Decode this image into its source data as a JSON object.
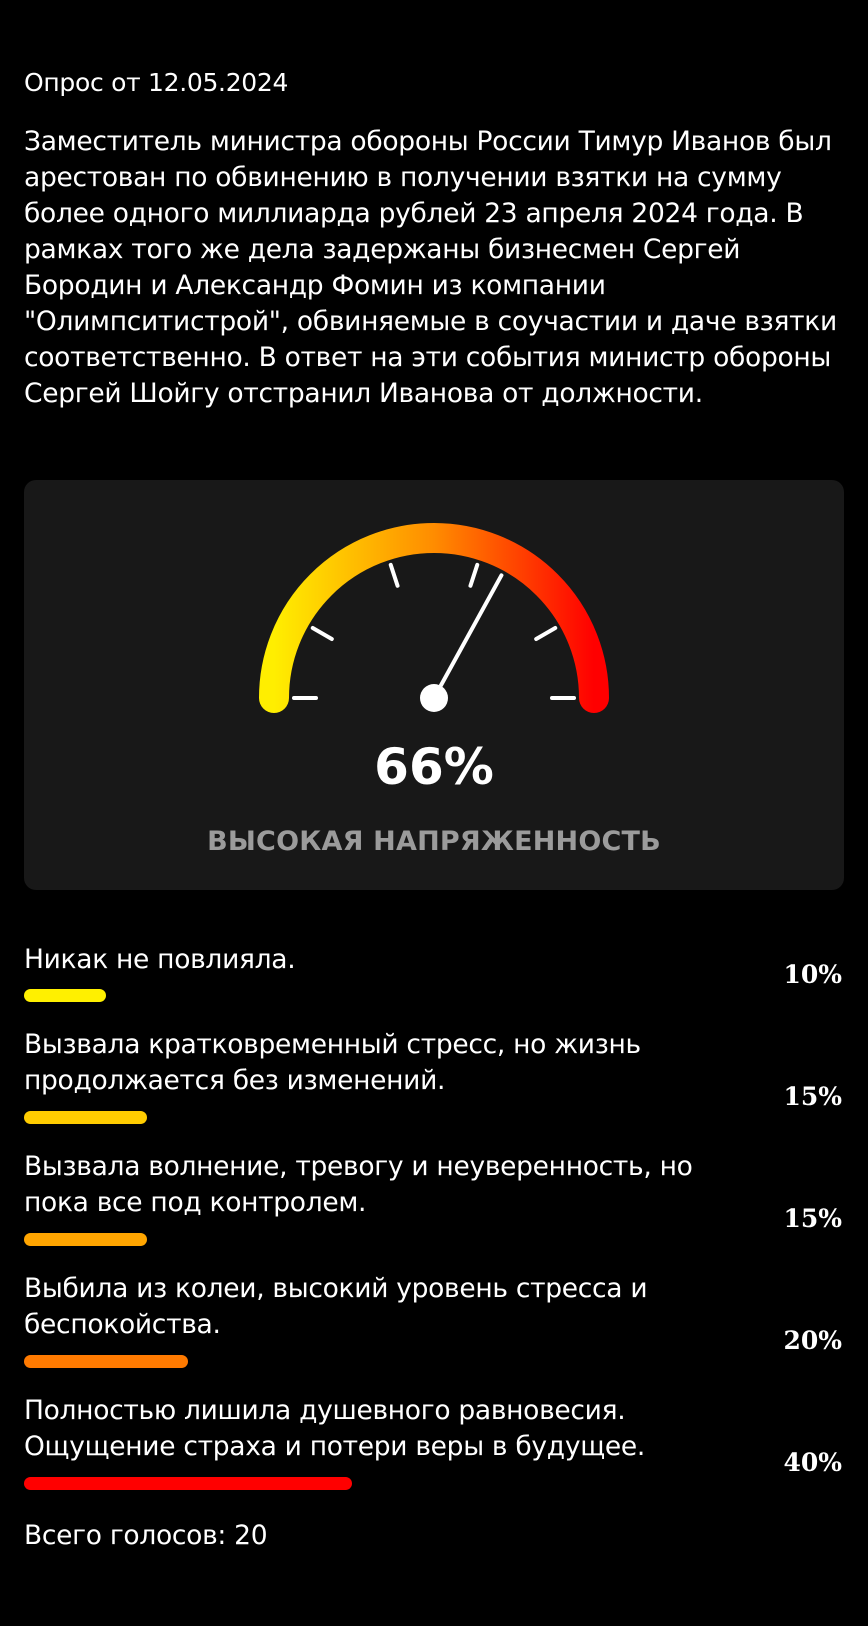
{
  "survey": {
    "date_label": "Опрос от 12.05.2024",
    "description": "Заместитель министра обороны России Тимур Иванов был арестован по обвинению в получении взятки на сумму более одного миллиарда рублей 23 апреля 2024 года. В рамках того же дела задержаны бизнесмен Сергей Бородин и Александр Фомин из компании \"Олимпситистрой\", обвиняемые в соучастии и даче взятки соответственно. В ответ на эти события министр обороны Сергей Шойгу отстранил Иванова от должности."
  },
  "gauge": {
    "value": 66,
    "percent_label": "66%",
    "level_label": "ВЫСОКАЯ НАПРЯЖЕННОСТЬ",
    "gradient_colors": [
      "#ffee00",
      "#ff8c00",
      "#ff0000"
    ]
  },
  "options": [
    {
      "label": "Никак не повлияла.",
      "percent": 10,
      "percent_label": "10%",
      "color": "#fff000"
    },
    {
      "label": "Вызвала кратковременный стресс, но жизнь продолжается без изменений.",
      "percent": 15,
      "percent_label": "15%",
      "color": "#ffcc00"
    },
    {
      "label": "Вызвала волнение, тревогу и неуверенность, но пока все под контролем.",
      "percent": 15,
      "percent_label": "15%",
      "color": "#ffa500"
    },
    {
      "label": "Выбила из колеи, высокий уровень стресса и беспокойства.",
      "percent": 20,
      "percent_label": "20%",
      "color": "#ff7a00"
    },
    {
      "label": "Полностью лишила душевного равновесия. Ощущение страха и потери веры в будущее.",
      "percent": 40,
      "percent_label": "40%",
      "color": "#ff0000"
    }
  ],
  "footer": {
    "total_votes_label": "Всего голосов: 20"
  }
}
